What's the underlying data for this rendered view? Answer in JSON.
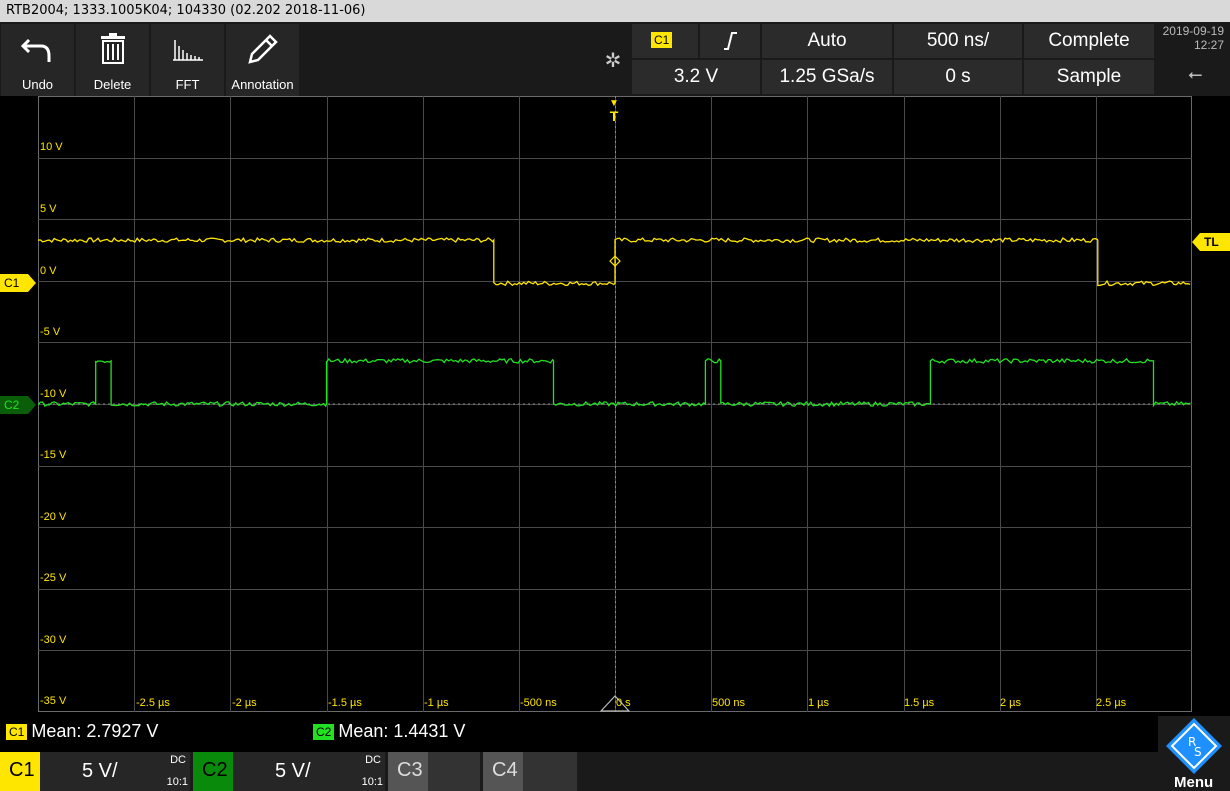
{
  "title_bar": {
    "text": "RTB2004; 1333.1005K04; 104330 (02.202 2018-11-06)"
  },
  "toolbar": {
    "buttons": [
      {
        "label": "Undo",
        "icon": "undo-icon"
      },
      {
        "label": "Delete",
        "icon": "trash-icon"
      },
      {
        "label": "FFT",
        "icon": "fft-icon"
      },
      {
        "label": "Annotation",
        "icon": "pencil-icon"
      }
    ],
    "settings_icon": "gear-icon"
  },
  "trigger": {
    "source": "C1",
    "slope": "rising-edge-icon",
    "mode": "Auto",
    "level": "3.2 V"
  },
  "timebase": {
    "scale": "500 ns/",
    "sample_rate": "1.25 GSa/s",
    "position": "0 s"
  },
  "acquisition": {
    "status": "Complete",
    "mode": "Sample"
  },
  "datetime": {
    "date": "2019-09-19",
    "time": "12:27"
  },
  "grid": {
    "y_labels": [
      "10 V",
      "5 V",
      "0 V",
      "-5 V",
      "-10 V",
      "-15 V",
      "-20 V",
      "-25 V",
      "-30 V",
      "-35 V"
    ],
    "x_labels": [
      "-2.5 µs",
      "-2 µs",
      "-1.5 µs",
      "-1 µs",
      "-500 ns",
      "0 s",
      "500 ns",
      "1 µs",
      "1.5 µs",
      "2 µs",
      "2.5 µs"
    ],
    "trigger_marker": "T",
    "trigger_level_marker": "TL"
  },
  "channels": {
    "c1": {
      "name": "C1",
      "color": "#ffe600",
      "scale": "5 V/",
      "coupling": "DC",
      "probe": "10:1",
      "mean": "Mean: 2.7927 V"
    },
    "c2": {
      "name": "C2",
      "color": "#22e022",
      "scale": "5 V/",
      "coupling": "DC",
      "probe": "10:1",
      "mean": "Mean: 1.4431 V"
    },
    "c3": {
      "name": "C3"
    },
    "c4": {
      "name": "C4"
    }
  },
  "menu": {
    "label": "Menu",
    "logo": "rohde-schwarz-logo-icon"
  },
  "chart_data": {
    "type": "line",
    "x_unit": "s",
    "y_unit": "V",
    "xlim": [
      -3e-06,
      3e-06
    ],
    "ylim": [
      -35,
      15
    ],
    "series": [
      {
        "name": "C1",
        "color": "#ffe600",
        "x": [
          -3e-06,
          -6.3e-07,
          -6.3e-07,
          0.0,
          0.0,
          2.51e-06,
          2.51e-06,
          3e-06
        ],
        "y": [
          3.3,
          3.3,
          -0.2,
          -0.2,
          3.3,
          3.3,
          -0.2,
          -0.2
        ]
      },
      {
        "name": "C2",
        "color": "#22e022",
        "x": [
          -3e-06,
          -2.7e-06,
          -2.7e-06,
          -2.62e-06,
          -2.62e-06,
          -1.5e-06,
          -1.5e-06,
          -3.2e-07,
          -3.2e-07,
          4.7e-07,
          4.7e-07,
          5.5e-07,
          5.5e-07,
          1.64e-06,
          1.64e-06,
          2.8e-06,
          2.8e-06,
          3e-06
        ],
        "y": [
          -10.0,
          -10.0,
          -6.5,
          -6.5,
          -10.0,
          -10.0,
          -6.5,
          -6.5,
          -10.0,
          -10.0,
          -6.5,
          -6.5,
          -10.0,
          -10.0,
          -6.5,
          -6.5,
          -10.0,
          -10.0
        ]
      }
    ]
  }
}
